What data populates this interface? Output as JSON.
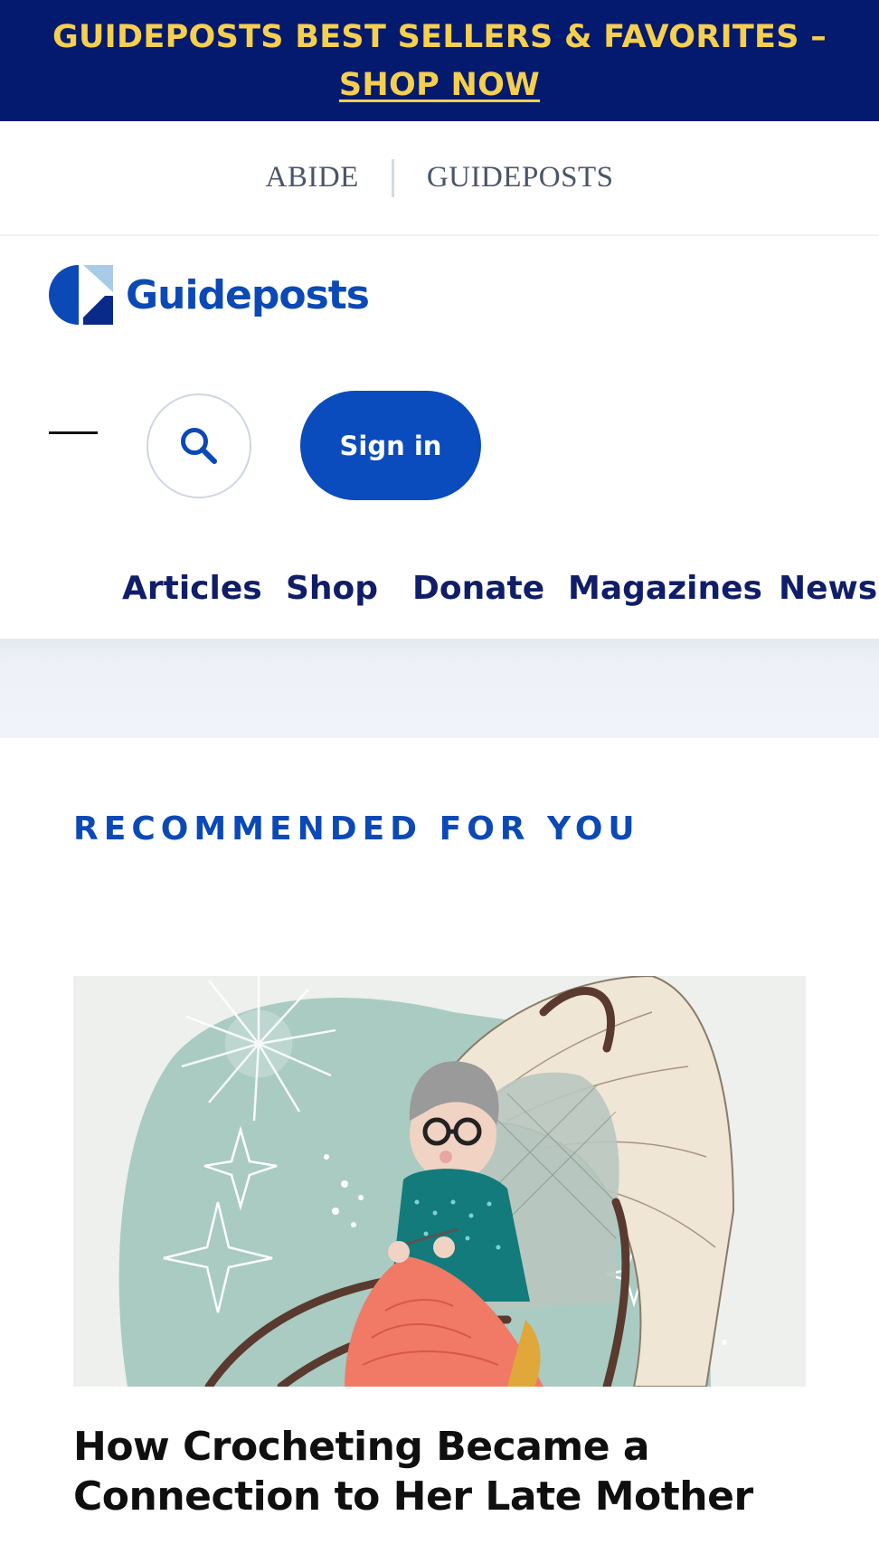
{
  "promo_banner": {
    "line1": "GUIDEPOSTS BEST SELLERS & FAVORITES –",
    "line2": "SHOP NOW"
  },
  "site_switcher": {
    "items": [
      "ABIDE",
      "GUIDEPOSTS"
    ]
  },
  "header": {
    "logo_text": "Guideposts",
    "menu_icon": "menu-icon",
    "search_icon": "search-icon",
    "signin_label": "Sign in"
  },
  "main_nav": {
    "items": [
      "Articles",
      "Shop",
      "Donate",
      "Magazines",
      "Newsle"
    ]
  },
  "recommended": {
    "heading": "RECOMMENDED FOR YOU",
    "card": {
      "title": "How Crocheting Became a Connection to Her Late Mother"
    }
  },
  "colors": {
    "promo_bg": "#031a6e",
    "promo_text": "#f6cf4e",
    "brand_blue": "#0b49b6",
    "nav_text": "#101d68"
  }
}
